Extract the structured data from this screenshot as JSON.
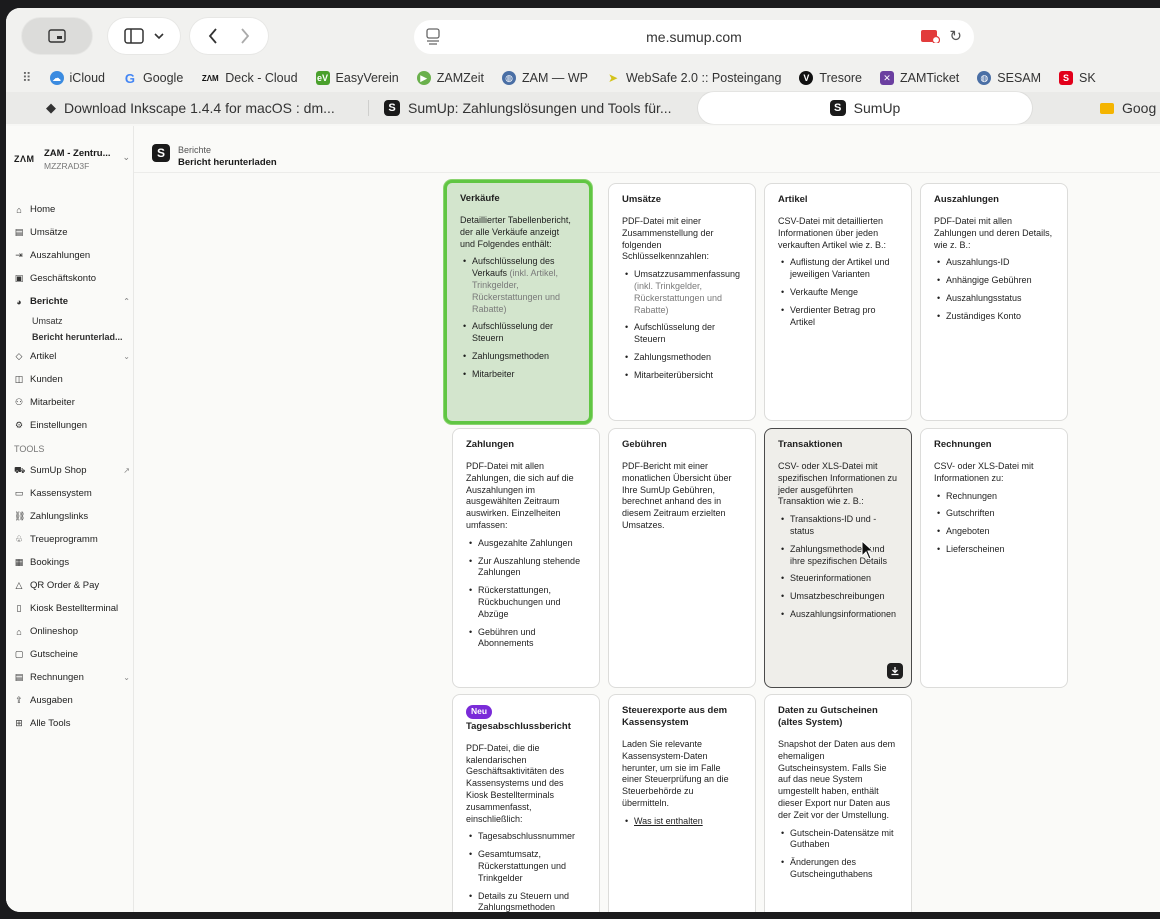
{
  "browser": {
    "url": "me.sumup.com",
    "bookmarks": [
      "iCloud",
      "Google",
      "Deck - Cloud",
      "EasyVerein",
      "ZAMZeit",
      "ZAM — WP",
      "WebSafe 2.0 :: Posteingang",
      "Tresore",
      "ZAMTicket",
      "SESAM",
      "SK"
    ],
    "tabs": [
      {
        "label": "Download Inkscape 1.4.4 for macOS : dm..."
      },
      {
        "label": "SumUp: Zahlungslösungen und Tools für..."
      },
      {
        "label": "SumUp"
      },
      {
        "label": "Goog"
      }
    ]
  },
  "org": {
    "mark": "ZΛM",
    "name": "ZAM - Zentru...",
    "id": "MZZRAD3F"
  },
  "nav": {
    "items": [
      "Home",
      "Umsätze",
      "Auszahlungen",
      "Geschäftskonto",
      "Berichte"
    ],
    "sub": [
      "Umsatz",
      "Bericht herunterlad..."
    ],
    "items2": [
      "Artikel",
      "Kunden",
      "Mitarbeiter",
      "Einstellungen"
    ],
    "tools_heading": "TOOLS",
    "tools": [
      "SumUp Shop",
      "Kassensystem",
      "Zahlungslinks",
      "Treueprogramm",
      "Bookings",
      "QR Order & Pay",
      "Kiosk Bestellterminal",
      "Onlineshop",
      "Gutscheine",
      "Rechnungen",
      "Ausgaben",
      "Alle Tools"
    ]
  },
  "breadcrumb": {
    "parent": "Berichte",
    "current": "Bericht herunterladen"
  },
  "cards": {
    "verkaeufe": {
      "title": "Verkäufe",
      "desc": "Detaillierter Tabellenbericht, der alle Verkäufe anzeigt und Folgendes enthält:",
      "b1": "Aufschlüsselung des Verkaufs",
      "b1_note": "(inkl. Artikel, Trinkgelder, Rückerstattungen und Rabatte)",
      "b2": "Aufschlüsselung der Steuern",
      "b3": "Zahlungsmethoden",
      "b4": "Mitarbeiter"
    },
    "umsaetze": {
      "title": "Umsätze",
      "desc": "PDF-Datei mit einer Zusammenstellung der folgenden Schlüsselkennzahlen:",
      "b1": "Umsatzzusammenfassung",
      "b1_note": "(inkl. Trinkgelder, Rückerstattungen und Rabatte)",
      "b2": "Aufschlüsselung der Steuern",
      "b3": "Zahlungsmethoden",
      "b4": "Mitarbeiterübersicht"
    },
    "artikel": {
      "title": "Artikel",
      "desc": "CSV-Datei mit detaillierten Informationen über jeden verkauften Artikel wie z. B.:",
      "b1": "Auflistung der Artikel und jeweiligen Varianten",
      "b2": "Verkaufte Menge",
      "b3": "Verdienter Betrag pro Artikel"
    },
    "auszahlungen": {
      "title": "Auszahlungen",
      "desc": "PDF-Datei mit allen Zahlungen und deren Details, wie z. B.:",
      "b1": "Auszahlungs-ID",
      "b2": "Anhängige Gebühren",
      "b3": "Auszahlungsstatus",
      "b4": "Zuständiges Konto"
    },
    "zahlungen": {
      "title": "Zahlungen",
      "desc": "PDF-Datei mit allen Zahlungen, die sich auf die Auszahlungen im ausgewählten Zeitraum auswirken. Einzelheiten umfassen:",
      "b1": "Ausgezahlte Zahlungen",
      "b2": "Zur Auszahlung stehende Zahlungen",
      "b3": "Rückerstattungen, Rückbuchungen und Abzüge",
      "b4": "Gebühren und Abonnements"
    },
    "gebuehren": {
      "title": "Gebühren",
      "desc": "PDF-Bericht mit einer monatlichen Übersicht über Ihre SumUp Gebühren, berechnet anhand des in diesem Zeitraum erzielten Umsatzes."
    },
    "transaktionen": {
      "title": "Transaktionen",
      "desc": "CSV- oder XLS-Datei mit spezifischen Informationen zu jeder ausgeführten Transaktion wie z. B.:",
      "b1": "Transaktions-ID und -status",
      "b2": "Zahlungsmethoden und ihre spezifischen Details",
      "b3": "Steuerinformationen",
      "b4": "Umsatzbeschreibungen",
      "b5": "Auszahlungsinformationen"
    },
    "rechnungen": {
      "title": "Rechnungen",
      "desc": "CSV- oder XLS-Datei mit Informationen zu:",
      "b1": "Rechnungen",
      "b2": "Gutschriften",
      "b3": "Angeboten",
      "b4": "Lieferscheinen"
    },
    "tagesabschluss": {
      "badge": "Neu",
      "title": "Tagesabschlussbericht",
      "desc": "PDF-Datei, die die kalendarischen Geschäftsaktivitäten des Kassensystems und des Kiosk Bestellterminals zusammenfasst, einschließlich:",
      "b1": "Tagesabschlussnummer",
      "b2": "Gesamtumsatz, Rückerstattungen und Trinkgelder",
      "b3": "Details zu Steuern und Zahlungsmethoden"
    },
    "steuerexporte": {
      "title": "Steuerexporte aus dem Kassensystem",
      "desc": "Laden Sie relevante Kassensystem-Daten herunter, um sie im Falle einer Steuerprüfung an die Steuerbehörde zu übermitteln.",
      "link": "Was ist enthalten"
    },
    "gutscheine": {
      "title": "Daten zu Gutscheinen (altes System)",
      "desc": "Snapshot der Daten aus dem ehemaligen Gutscheinsystem. Falls Sie auf das neue System umgestellt haben, enthält dieser Export nur Daten aus der Zeit vor der Umstellung.",
      "b1": "Gutschein-Datensätze mit Guthaben",
      "b2": "Änderungen des Gutscheinguthabens"
    }
  },
  "colors": {
    "selected_border": "#60c643",
    "selected_bg": "#d3e5cd",
    "badge": "#7a2bd8"
  }
}
